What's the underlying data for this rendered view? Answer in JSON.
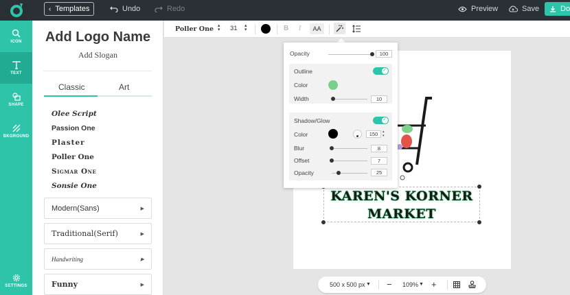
{
  "topbar": {
    "templates_label": "Templates",
    "undo_label": "Undo",
    "redo_label": "Redo",
    "preview_label": "Preview",
    "save_label": "Save",
    "download_label": "Do"
  },
  "nav": {
    "items": [
      {
        "label": "ICON",
        "icon": "search-icon"
      },
      {
        "label": "TEXT",
        "icon": "text-icon"
      },
      {
        "label": "SHAPE",
        "icon": "shapes-icon"
      },
      {
        "label": "BKGROUND",
        "icon": "background-icon"
      }
    ],
    "settings_label": "SETTINGS"
  },
  "panel": {
    "title": "Add Logo Name",
    "slogan": "Add Slogan",
    "tabs": [
      "Classic",
      "Art"
    ],
    "fonts": [
      "Olee Script",
      "Passion One",
      "Plaster",
      "Poller One",
      "Sigmar One",
      "Sonsie One"
    ],
    "categories": [
      "Modern(Sans)",
      "Traditional(Serif)",
      "Handwriting",
      "Funny"
    ]
  },
  "toolbar": {
    "font_name": "Poller One",
    "font_size": "31",
    "bold_label": "B",
    "italic_label": "I",
    "case_label": "AA",
    "text_color": "#000000"
  },
  "canvas": {
    "logo_line1": "KAREN'S KORNER",
    "logo_line2": "MARKET"
  },
  "zoombar": {
    "size_label": "500 x 500 px",
    "zoom_label": "109%",
    "minus": "−",
    "plus": "+"
  },
  "effects": {
    "opacity_label": "Opacity",
    "opacity_value": "100",
    "outline_label": "Outline",
    "outline_enabled": true,
    "outline_color_label": "Color",
    "outline_color": "#7ccf8a",
    "outline_width_label": "Width",
    "outline_width": "10",
    "shadow_label": "Shadow/Glow",
    "shadow_enabled": true,
    "shadow_color_label": "Color",
    "shadow_color": "#000000",
    "shadow_angle": "150",
    "blur_label": "Blur",
    "blur_value": "8",
    "offset_label": "Offset",
    "offset_value": "7",
    "shadow_opacity_label": "Opacity",
    "shadow_opacity_value": "25"
  },
  "colors": {
    "accent": "#2ec4a9",
    "topbar": "#2b2f36"
  }
}
